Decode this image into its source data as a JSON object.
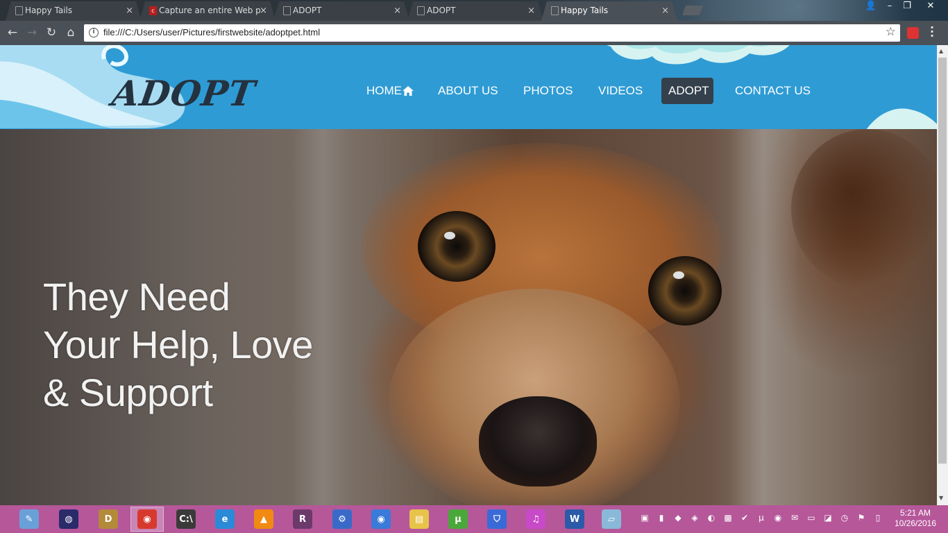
{
  "browser": {
    "tabs": [
      {
        "title": "Happy Tails",
        "icon": "page-icon"
      },
      {
        "title": "Capture an entire Web p",
        "icon": "capture-icon"
      },
      {
        "title": "ADOPT",
        "icon": "page-icon"
      },
      {
        "title": "ADOPT",
        "icon": "page-icon"
      },
      {
        "title": "Happy Tails",
        "icon": "page-icon",
        "active": true
      }
    ],
    "close_glyph": "×",
    "url": "file:///C:/Users/user/Pictures/firstwebsite/adoptpet.html",
    "window_controls": {
      "minimize": "–",
      "restore": "❐",
      "close": "✕"
    }
  },
  "site": {
    "logo": "ADOPT",
    "nav": [
      {
        "label": "HOME",
        "icon": "home-icon"
      },
      {
        "label": "ABOUT US"
      },
      {
        "label": "PHOTOS"
      },
      {
        "label": "VIDEOS"
      },
      {
        "label": "ADOPT",
        "active": true
      },
      {
        "label": "CONTACT US"
      }
    ],
    "hero": {
      "line1": "They Need",
      "line2": "Your Help, Love",
      "line3": "& Support"
    },
    "colors": {
      "header": "#2f9bd4",
      "nav_active": "#34404c",
      "logo": "#243240"
    }
  },
  "taskbar": {
    "apps": [
      {
        "name": "paint-icon",
        "glyph": "✎",
        "color": "#6aa0d8"
      },
      {
        "name": "eclipse-icon",
        "glyph": "◍",
        "color": "#2b2a6a"
      },
      {
        "name": "dosbox-icon",
        "glyph": "D",
        "color": "#b38a3a"
      },
      {
        "name": "chrome-icon",
        "glyph": "◉",
        "color": "#d63a2e",
        "active": true
      },
      {
        "name": "cmd-icon",
        "glyph": "C:\\",
        "color": "#3a3a3a"
      },
      {
        "name": "ie-icon",
        "glyph": "e",
        "color": "#2a8ad8"
      },
      {
        "name": "vlc-icon",
        "glyph": "▲",
        "color": "#f08a12"
      },
      {
        "name": "winrar-icon",
        "glyph": "R",
        "color": "#6b3a6b"
      },
      {
        "name": "tool-icon",
        "glyph": "⚙",
        "color": "#3a6ac8"
      },
      {
        "name": "chromium-icon",
        "glyph": "◉",
        "color": "#3a7ad8"
      },
      {
        "name": "explorer-icon",
        "glyph": "▤",
        "color": "#e8c34a"
      },
      {
        "name": "utorrent-icon",
        "glyph": "µ",
        "color": "#4aa83a"
      },
      {
        "name": "shield-icon",
        "glyph": "⛉",
        "color": "#3a6ad8"
      },
      {
        "name": "itunes-icon",
        "glyph": "♫",
        "color": "#c84ac8"
      },
      {
        "name": "word-icon",
        "glyph": "W",
        "color": "#2a5aa8"
      },
      {
        "name": "notes-icon",
        "glyph": "▱",
        "color": "#8ab8d8"
      }
    ],
    "clock": {
      "time": "5:21 AM",
      "date": "10/26/2016"
    }
  }
}
